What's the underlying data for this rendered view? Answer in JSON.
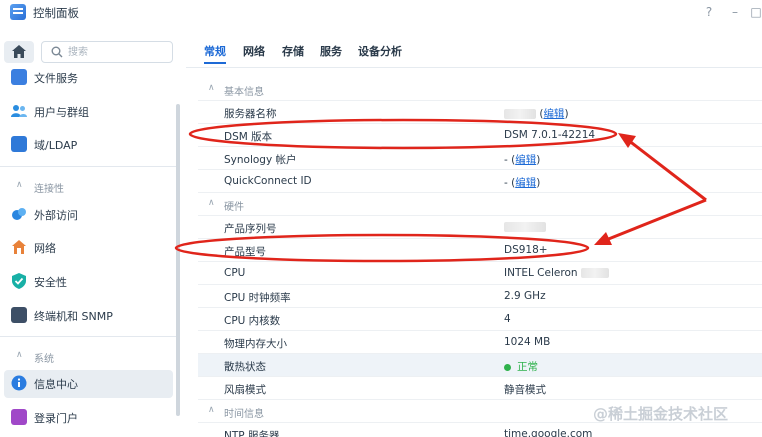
{
  "window": {
    "title": "控制面板",
    "help_btn": "?",
    "min_btn": "–",
    "max_btn": "□"
  },
  "sidebar": {
    "search_placeholder": "搜索",
    "items_top": [
      {
        "label": "文件服务",
        "icon": "file-services-icon"
      },
      {
        "label": "用户与群组",
        "icon": "users-groups-icon"
      },
      {
        "label": "域/LDAP",
        "icon": "domain-ldap-icon"
      }
    ],
    "section_connectivity": "连接性",
    "items_connectivity": [
      {
        "label": "外部访问",
        "icon": "external-access-icon"
      },
      {
        "label": "网络",
        "icon": "network-icon"
      },
      {
        "label": "安全性",
        "icon": "security-icon"
      },
      {
        "label": "终端机和 SNMP",
        "icon": "terminal-snmp-icon"
      }
    ],
    "section_system": "系统",
    "items_system": [
      {
        "label": "信息中心",
        "icon": "info-center-icon",
        "active": true
      },
      {
        "label": "登录门户",
        "icon": "login-portal-icon"
      }
    ]
  },
  "tabs": [
    "常规",
    "网络",
    "存储",
    "服务",
    "设备分析"
  ],
  "sections": {
    "basic": "基本信息",
    "hardware": "硬件",
    "time": "时间信息"
  },
  "basic_rows": [
    {
      "key": "服务器名称",
      "value": "",
      "link": "编辑"
    },
    {
      "key": "DSM 版本",
      "value": "DSM 7.0.1-42214"
    },
    {
      "key": "Synology 帐户",
      "value": "- (",
      "link": "编辑"
    },
    {
      "key": "QuickConnect ID",
      "value": "- (",
      "link": "编辑"
    }
  ],
  "hardware_rows": [
    {
      "key": "产品序列号",
      "value": ""
    },
    {
      "key": "产品型号",
      "value": "DS918+"
    },
    {
      "key": "CPU",
      "value": "INTEL Celeron"
    },
    {
      "key": "CPU 时钟频率",
      "value": "2.9 GHz"
    },
    {
      "key": "CPU 内核数",
      "value": "4"
    },
    {
      "key": "物理内存大小",
      "value": "1024 MB"
    },
    {
      "key": "散热状态",
      "value": "正常"
    },
    {
      "key": "风扇模式",
      "value": "静音模式"
    }
  ],
  "time_rows": [
    {
      "key": "NTP 服务器",
      "value": "time.google.com"
    }
  ],
  "colors": {
    "accent": "#1d6ad6",
    "annotation": "#e0251b",
    "ok": "#2fb24c"
  },
  "watermark": "@稀土掘金技术社区"
}
